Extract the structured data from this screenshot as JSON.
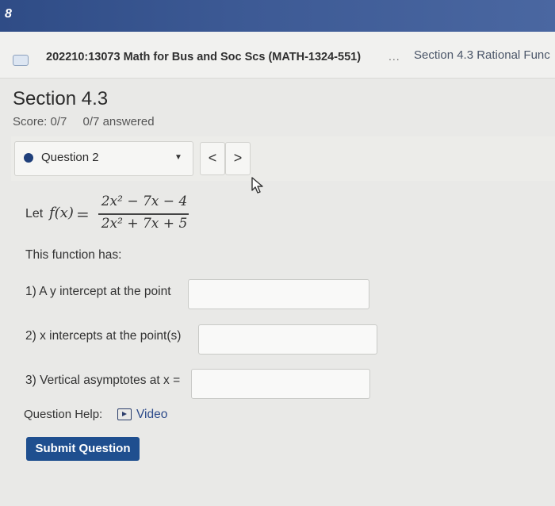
{
  "topbar": {
    "menu_glyph": "8"
  },
  "breadcrumb": {
    "course": "202210:13073 Math for Bus and Soc Scs (MATH-1324-551)",
    "separator": "...",
    "current": "Section 4.3 Rational Func"
  },
  "section": {
    "title": "Section 4.3",
    "score": "Score: 0/7",
    "answered": "0/7 answered"
  },
  "question_nav": {
    "label": "Question 2",
    "prev": "<",
    "next": ">"
  },
  "problem": {
    "intro": "Let",
    "function_name": "f(x)",
    "equals": "=",
    "numerator": "2x² − 7x − 4",
    "denominator": "2x² + 7x + 5",
    "sentence": "This function has:",
    "parts": [
      {
        "label": "1) A y intercept at the point",
        "value": ""
      },
      {
        "label": "2) x intercepts at the point(s)",
        "value": ""
      },
      {
        "label": "3) Vertical asymptotes at x =",
        "value": ""
      }
    ]
  },
  "help": {
    "label": "Question Help:",
    "video": "Video"
  },
  "submit_label": "Submit Question",
  "colors": {
    "topbar": "#2f4c86",
    "submit": "#1f4f8f",
    "link": "#2c4a8a"
  }
}
